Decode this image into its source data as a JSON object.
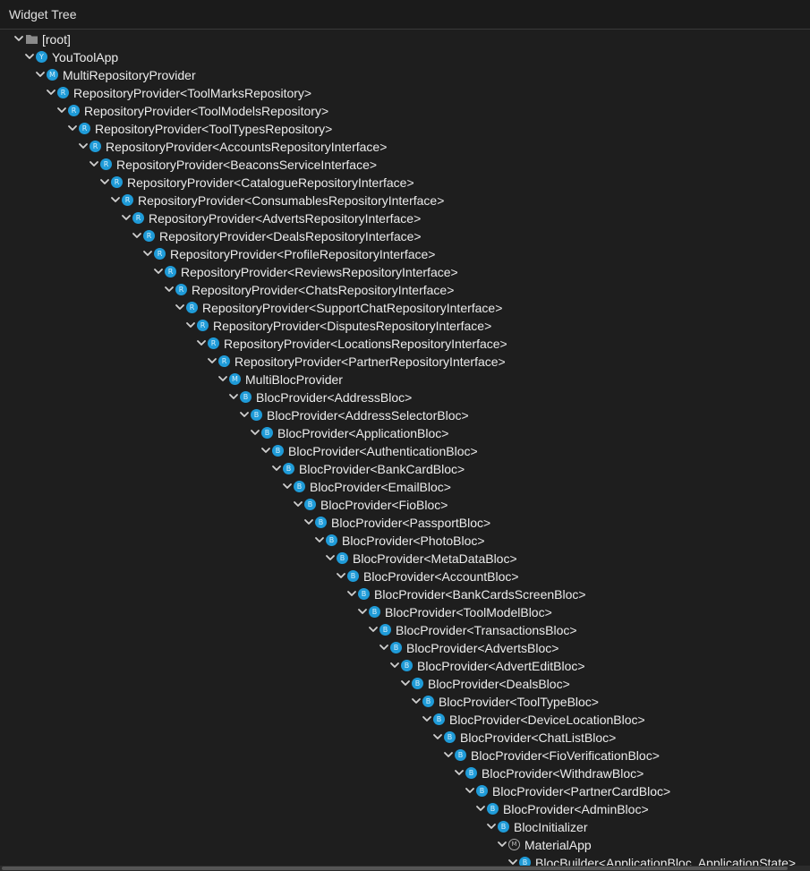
{
  "panel": {
    "title": "Widget Tree"
  },
  "tree": [
    {
      "label": "[root]",
      "icon": "folder-icon",
      "letter": ""
    },
    {
      "label": "YouToolApp",
      "icon": "widget-icon",
      "letter": "Y"
    },
    {
      "label": "MultiRepositoryProvider",
      "icon": "widget-icon",
      "letter": "M"
    },
    {
      "label": "RepositoryProvider<ToolMarksRepository>",
      "icon": "widget-icon",
      "letter": "R"
    },
    {
      "label": "RepositoryProvider<ToolModelsRepository>",
      "icon": "widget-icon",
      "letter": "R"
    },
    {
      "label": "RepositoryProvider<ToolTypesRepository>",
      "icon": "widget-icon",
      "letter": "R"
    },
    {
      "label": "RepositoryProvider<AccountsRepositoryInterface>",
      "icon": "widget-icon",
      "letter": "R"
    },
    {
      "label": "RepositoryProvider<BeaconsServiceInterface>",
      "icon": "widget-icon",
      "letter": "R"
    },
    {
      "label": "RepositoryProvider<CatalogueRepositoryInterface>",
      "icon": "widget-icon",
      "letter": "R"
    },
    {
      "label": "RepositoryProvider<ConsumablesRepositoryInterface>",
      "icon": "widget-icon",
      "letter": "R"
    },
    {
      "label": "RepositoryProvider<AdvertsRepositoryInterface>",
      "icon": "widget-icon",
      "letter": "R"
    },
    {
      "label": "RepositoryProvider<DealsRepositoryInterface>",
      "icon": "widget-icon",
      "letter": "R"
    },
    {
      "label": "RepositoryProvider<ProfileRepositoryInterface>",
      "icon": "widget-icon",
      "letter": "R"
    },
    {
      "label": "RepositoryProvider<ReviewsRepositoryInterface>",
      "icon": "widget-icon",
      "letter": "R"
    },
    {
      "label": "RepositoryProvider<ChatsRepositoryInterface>",
      "icon": "widget-icon",
      "letter": "R"
    },
    {
      "label": "RepositoryProvider<SupportChatRepositoryInterface>",
      "icon": "widget-icon",
      "letter": "R"
    },
    {
      "label": "RepositoryProvider<DisputesRepositoryInterface>",
      "icon": "widget-icon",
      "letter": "R"
    },
    {
      "label": "RepositoryProvider<LocationsRepositoryInterface>",
      "icon": "widget-icon",
      "letter": "R"
    },
    {
      "label": "RepositoryProvider<PartnerRepositoryInterface>",
      "icon": "widget-icon",
      "letter": "R"
    },
    {
      "label": "MultiBlocProvider",
      "icon": "widget-icon",
      "letter": "M"
    },
    {
      "label": "BlocProvider<AddressBloc>",
      "icon": "widget-icon",
      "letter": "B"
    },
    {
      "label": "BlocProvider<AddressSelectorBloc>",
      "icon": "widget-icon",
      "letter": "B"
    },
    {
      "label": "BlocProvider<ApplicationBloc>",
      "icon": "widget-icon",
      "letter": "B"
    },
    {
      "label": "BlocProvider<AuthenticationBloc>",
      "icon": "widget-icon",
      "letter": "B"
    },
    {
      "label": "BlocProvider<BankCardBloc>",
      "icon": "widget-icon",
      "letter": "B"
    },
    {
      "label": "BlocProvider<EmailBloc>",
      "icon": "widget-icon",
      "letter": "B"
    },
    {
      "label": "BlocProvider<FioBloc>",
      "icon": "widget-icon",
      "letter": "B"
    },
    {
      "label": "BlocProvider<PassportBloc>",
      "icon": "widget-icon",
      "letter": "B"
    },
    {
      "label": "BlocProvider<PhotoBloc>",
      "icon": "widget-icon",
      "letter": "B"
    },
    {
      "label": "BlocProvider<MetaDataBloc>",
      "icon": "widget-icon",
      "letter": "B"
    },
    {
      "label": "BlocProvider<AccountBloc>",
      "icon": "widget-icon",
      "letter": "B"
    },
    {
      "label": "BlocProvider<BankCardsScreenBloc>",
      "icon": "widget-icon",
      "letter": "B"
    },
    {
      "label": "BlocProvider<ToolModelBloc>",
      "icon": "widget-icon",
      "letter": "B"
    },
    {
      "label": "BlocProvider<TransactionsBloc>",
      "icon": "widget-icon",
      "letter": "B"
    },
    {
      "label": "BlocProvider<AdvertsBloc>",
      "icon": "widget-icon",
      "letter": "B"
    },
    {
      "label": "BlocProvider<AdvertEditBloc>",
      "icon": "widget-icon",
      "letter": "B"
    },
    {
      "label": "BlocProvider<DealsBloc>",
      "icon": "widget-icon",
      "letter": "B"
    },
    {
      "label": "BlocProvider<ToolTypeBloc>",
      "icon": "widget-icon",
      "letter": "B"
    },
    {
      "label": "BlocProvider<DeviceLocationBloc>",
      "icon": "widget-icon",
      "letter": "B"
    },
    {
      "label": "BlocProvider<ChatListBloc>",
      "icon": "widget-icon",
      "letter": "B"
    },
    {
      "label": "BlocProvider<FioVerificationBloc>",
      "icon": "widget-icon",
      "letter": "B"
    },
    {
      "label": "BlocProvider<WithdrawBloc>",
      "icon": "widget-icon",
      "letter": "B"
    },
    {
      "label": "BlocProvider<PartnerCardBloc>",
      "icon": "widget-icon",
      "letter": "B"
    },
    {
      "label": "BlocProvider<AdminBloc>",
      "icon": "widget-icon",
      "letter": "B"
    },
    {
      "label": "BlocInitializer",
      "icon": "widget-icon",
      "letter": "B"
    },
    {
      "label": "MaterialApp",
      "icon": "material-icon",
      "letter": "M"
    },
    {
      "label": "BlocBuilder<ApplicationBloc, ApplicationState>",
      "icon": "widget-icon",
      "letter": "B"
    }
  ]
}
